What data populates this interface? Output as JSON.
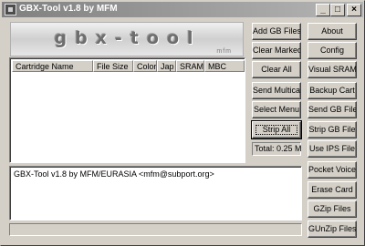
{
  "window": {
    "title": "GBX-Tool v1.8 by MFM",
    "minimize_label": "_",
    "maximize_label": "□",
    "close_label": "×"
  },
  "logo": {
    "text": "gbx-tool",
    "subtext": "mfm"
  },
  "cartridge_list": {
    "columns": [
      "Cartridge Name",
      "File Size",
      "Color",
      "Jap",
      "SRAM",
      "MBC"
    ],
    "rows": []
  },
  "log": {
    "text": "GBX-Tool v1.8 by MFM/EURASIA <mfm@subport.org>"
  },
  "total": {
    "label": "Total: 0.25 M"
  },
  "buttons_left": [
    {
      "label": "Add GB Files"
    },
    {
      "label": "Clear Marked"
    },
    {
      "label": "Clear All"
    },
    {
      "label": "Send Multicart"
    },
    {
      "label": "Select Menu"
    },
    {
      "label": "Strip All"
    }
  ],
  "buttons_right": [
    {
      "label": "About"
    },
    {
      "label": "Config"
    },
    {
      "label": "Visual SRAM"
    },
    {
      "label": "Backup Cart"
    },
    {
      "label": "Send GB File"
    },
    {
      "label": "Strip GB File"
    },
    {
      "label": "Use IPS File"
    },
    {
      "label": "Pocket Voice"
    },
    {
      "label": "Erase Card"
    },
    {
      "label": "GZip Files"
    },
    {
      "label": "GUnZip Files"
    }
  ]
}
